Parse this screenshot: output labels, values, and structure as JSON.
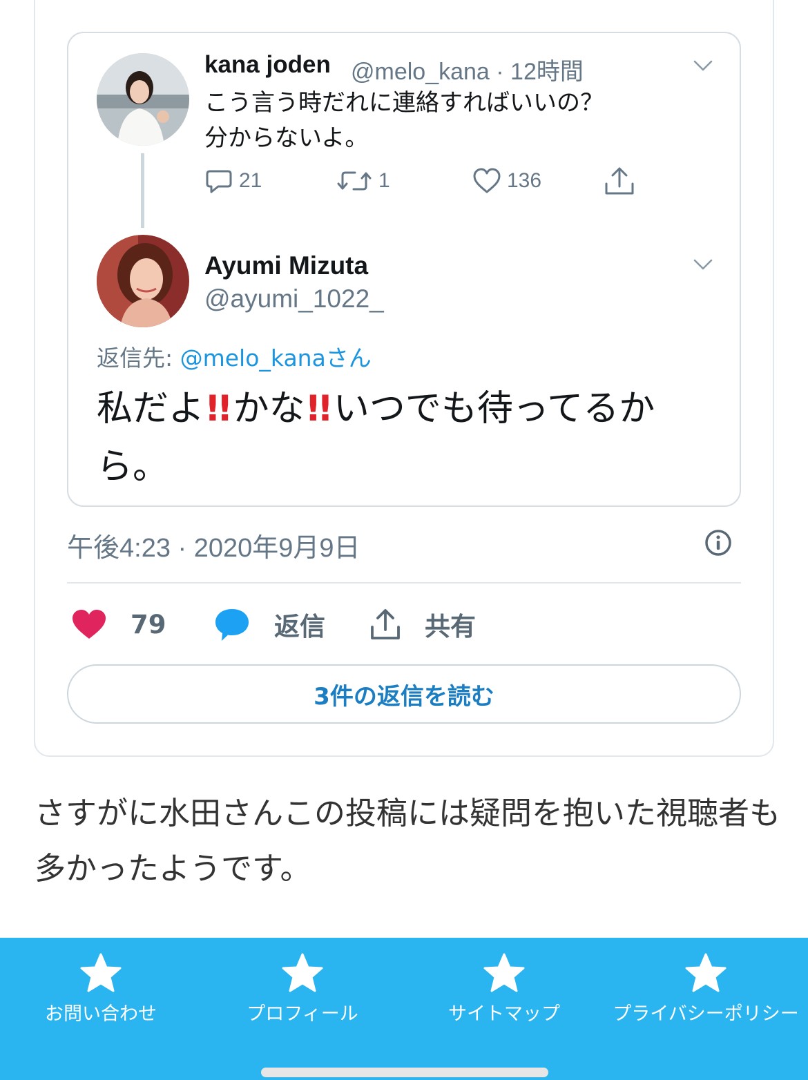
{
  "quoted_tweet": {
    "name": "kana joden",
    "handle_time": "@melo_kana · 12時間",
    "text_line1": "こう言う時だれに連絡すればいいの？",
    "text_line2": "分からないよ。",
    "reply_count": "21",
    "retweet_count": "1",
    "like_count": "136"
  },
  "reply_tweet": {
    "name": "Ayumi Mizuta",
    "handle": "@ayumi_1022_",
    "reply_to_prefix": "返信先: ",
    "reply_to_mention": "@melo_kanaさん",
    "text_part1": "私だよ",
    "bang1": "!!",
    "text_part2": "かな",
    "bang2": "!!",
    "text_part3": "いつでも待ってるから。"
  },
  "embed_footer": {
    "timestamp": "午後4:23 · 2020年9月9日",
    "like_count": "79",
    "reply_label": "返信",
    "share_label": "共有",
    "read_replies_label": "3件の返信を読む"
  },
  "article": {
    "paragraph": "さすがに水田さんこの投稿には疑問を抱いた視聴者も多かったようです。"
  },
  "bottom_nav": {
    "items": [
      {
        "label": "お問い合わせ",
        "icon": "star-icon"
      },
      {
        "label": "プロフィール",
        "icon": "star-icon"
      },
      {
        "label": "サイトマップ",
        "icon": "star-icon"
      },
      {
        "label": "プライバシーポリシー",
        "icon": "star-icon"
      }
    ]
  },
  "colors": {
    "nav_background": "#2ab5f0",
    "heart": "#e0245e",
    "reply_bubble": "#1da1f2",
    "link": "#1b95e0",
    "exclamation": "#e0232a"
  }
}
